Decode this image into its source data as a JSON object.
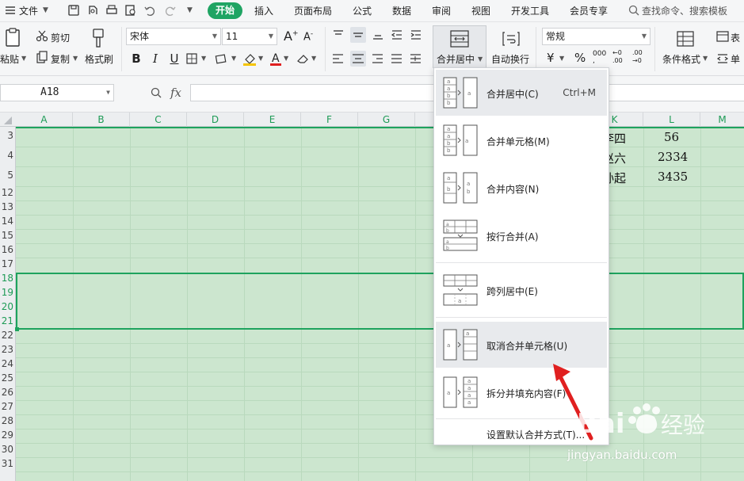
{
  "menubar": {
    "file": "文件",
    "tabs": [
      "开始",
      "插入",
      "页面布局",
      "公式",
      "数据",
      "审阅",
      "视图",
      "开发工具",
      "会员专享"
    ],
    "search": "查找命令、搜索模板"
  },
  "ribbon": {
    "paste": "粘贴",
    "cut": "剪切",
    "copy": "复制",
    "format_painter": "格式刷",
    "font_name": "宋体",
    "font_size": "11",
    "merge_center": "合并居中",
    "wrap_text": "自动换行",
    "number_format": "常规",
    "cond_format": "条件格式",
    "table_style": "表",
    "cell": "单"
  },
  "formula_bar": {
    "name_box": "A18",
    "fx": "fx"
  },
  "sheet": {
    "columns": [
      "A",
      "B",
      "C",
      "D",
      "E",
      "F",
      "G",
      "H",
      "I",
      "J",
      "K",
      "L",
      "M"
    ],
    "rows": [
      "3",
      "4",
      "5",
      "12",
      "13",
      "14",
      "15",
      "16",
      "17",
      "18",
      "19",
      "20",
      "21",
      "22",
      "23",
      "24",
      "25",
      "26",
      "27",
      "28",
      "29",
      "30",
      "31"
    ],
    "cells": {
      "k3": "李四",
      "l3": "56",
      "k4": "赵六",
      "l4": "2334",
      "k5": "孙起",
      "l5": "3435"
    }
  },
  "dropdown": {
    "items": [
      {
        "label": "合并居中(C)",
        "shortcut": "Ctrl+M"
      },
      {
        "label": "合并单元格(M)"
      },
      {
        "label": "合并内容(N)"
      },
      {
        "label": "按行合并(A)"
      },
      {
        "label": "跨列居中(E)"
      },
      {
        "label": "取消合并单元格(U)"
      },
      {
        "label": "拆分并填充内容(F)"
      }
    ],
    "default_merge": "设置默认合并方式(T)..."
  },
  "watermark": {
    "logo_text": "Bai度经验",
    "url": "jingyan.baidu.com"
  },
  "colors": {
    "accent": "#1fa463",
    "sheet_bg": "#cce6cf",
    "arrow": "#e02020"
  }
}
